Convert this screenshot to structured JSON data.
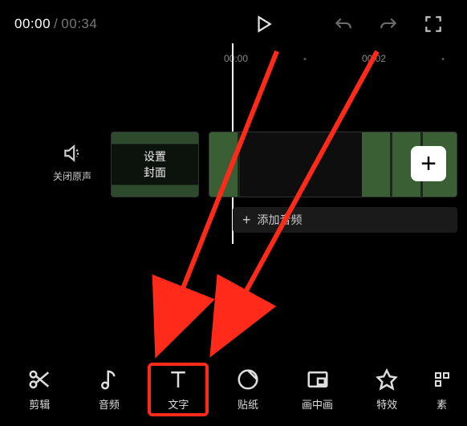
{
  "playback": {
    "current": "00:00",
    "separator": "/",
    "total": "00:34"
  },
  "ruler": {
    "t0": "00:00",
    "t1": "00:02"
  },
  "mute": {
    "label": "关闭原声"
  },
  "cover": {
    "label": "设置\n封面"
  },
  "addClip": {
    "glyph": "+"
  },
  "addAudio": {
    "plus": "+",
    "label": "添加音频"
  },
  "toolbar": {
    "cut": {
      "label": "剪辑"
    },
    "audio": {
      "label": "音频"
    },
    "text": {
      "label": "文字"
    },
    "sticker": {
      "label": "贴纸"
    },
    "pip": {
      "label": "画中画"
    },
    "fx": {
      "label": "特效"
    },
    "asset": {
      "label": "素"
    }
  }
}
